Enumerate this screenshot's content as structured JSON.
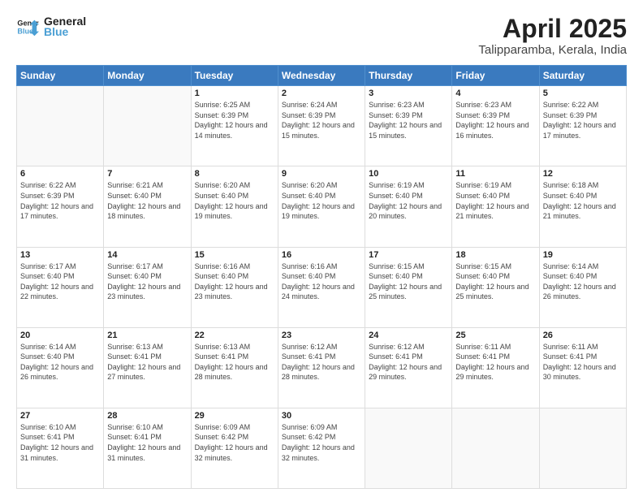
{
  "header": {
    "logo_line1": "General",
    "logo_line2": "Blue",
    "title": "April 2025",
    "subtitle": "Talipparamba, Kerala, India"
  },
  "weekdays": [
    "Sunday",
    "Monday",
    "Tuesday",
    "Wednesday",
    "Thursday",
    "Friday",
    "Saturday"
  ],
  "weeks": [
    [
      {
        "day": "",
        "info": ""
      },
      {
        "day": "",
        "info": ""
      },
      {
        "day": "1",
        "info": "Sunrise: 6:25 AM\nSunset: 6:39 PM\nDaylight: 12 hours and 14 minutes."
      },
      {
        "day": "2",
        "info": "Sunrise: 6:24 AM\nSunset: 6:39 PM\nDaylight: 12 hours and 15 minutes."
      },
      {
        "day": "3",
        "info": "Sunrise: 6:23 AM\nSunset: 6:39 PM\nDaylight: 12 hours and 15 minutes."
      },
      {
        "day": "4",
        "info": "Sunrise: 6:23 AM\nSunset: 6:39 PM\nDaylight: 12 hours and 16 minutes."
      },
      {
        "day": "5",
        "info": "Sunrise: 6:22 AM\nSunset: 6:39 PM\nDaylight: 12 hours and 17 minutes."
      }
    ],
    [
      {
        "day": "6",
        "info": "Sunrise: 6:22 AM\nSunset: 6:39 PM\nDaylight: 12 hours and 17 minutes."
      },
      {
        "day": "7",
        "info": "Sunrise: 6:21 AM\nSunset: 6:40 PM\nDaylight: 12 hours and 18 minutes."
      },
      {
        "day": "8",
        "info": "Sunrise: 6:20 AM\nSunset: 6:40 PM\nDaylight: 12 hours and 19 minutes."
      },
      {
        "day": "9",
        "info": "Sunrise: 6:20 AM\nSunset: 6:40 PM\nDaylight: 12 hours and 19 minutes."
      },
      {
        "day": "10",
        "info": "Sunrise: 6:19 AM\nSunset: 6:40 PM\nDaylight: 12 hours and 20 minutes."
      },
      {
        "day": "11",
        "info": "Sunrise: 6:19 AM\nSunset: 6:40 PM\nDaylight: 12 hours and 21 minutes."
      },
      {
        "day": "12",
        "info": "Sunrise: 6:18 AM\nSunset: 6:40 PM\nDaylight: 12 hours and 21 minutes."
      }
    ],
    [
      {
        "day": "13",
        "info": "Sunrise: 6:17 AM\nSunset: 6:40 PM\nDaylight: 12 hours and 22 minutes."
      },
      {
        "day": "14",
        "info": "Sunrise: 6:17 AM\nSunset: 6:40 PM\nDaylight: 12 hours and 23 minutes."
      },
      {
        "day": "15",
        "info": "Sunrise: 6:16 AM\nSunset: 6:40 PM\nDaylight: 12 hours and 23 minutes."
      },
      {
        "day": "16",
        "info": "Sunrise: 6:16 AM\nSunset: 6:40 PM\nDaylight: 12 hours and 24 minutes."
      },
      {
        "day": "17",
        "info": "Sunrise: 6:15 AM\nSunset: 6:40 PM\nDaylight: 12 hours and 25 minutes."
      },
      {
        "day": "18",
        "info": "Sunrise: 6:15 AM\nSunset: 6:40 PM\nDaylight: 12 hours and 25 minutes."
      },
      {
        "day": "19",
        "info": "Sunrise: 6:14 AM\nSunset: 6:40 PM\nDaylight: 12 hours and 26 minutes."
      }
    ],
    [
      {
        "day": "20",
        "info": "Sunrise: 6:14 AM\nSunset: 6:40 PM\nDaylight: 12 hours and 26 minutes."
      },
      {
        "day": "21",
        "info": "Sunrise: 6:13 AM\nSunset: 6:41 PM\nDaylight: 12 hours and 27 minutes."
      },
      {
        "day": "22",
        "info": "Sunrise: 6:13 AM\nSunset: 6:41 PM\nDaylight: 12 hours and 28 minutes."
      },
      {
        "day": "23",
        "info": "Sunrise: 6:12 AM\nSunset: 6:41 PM\nDaylight: 12 hours and 28 minutes."
      },
      {
        "day": "24",
        "info": "Sunrise: 6:12 AM\nSunset: 6:41 PM\nDaylight: 12 hours and 29 minutes."
      },
      {
        "day": "25",
        "info": "Sunrise: 6:11 AM\nSunset: 6:41 PM\nDaylight: 12 hours and 29 minutes."
      },
      {
        "day": "26",
        "info": "Sunrise: 6:11 AM\nSunset: 6:41 PM\nDaylight: 12 hours and 30 minutes."
      }
    ],
    [
      {
        "day": "27",
        "info": "Sunrise: 6:10 AM\nSunset: 6:41 PM\nDaylight: 12 hours and 31 minutes."
      },
      {
        "day": "28",
        "info": "Sunrise: 6:10 AM\nSunset: 6:41 PM\nDaylight: 12 hours and 31 minutes."
      },
      {
        "day": "29",
        "info": "Sunrise: 6:09 AM\nSunset: 6:42 PM\nDaylight: 12 hours and 32 minutes."
      },
      {
        "day": "30",
        "info": "Sunrise: 6:09 AM\nSunset: 6:42 PM\nDaylight: 12 hours and 32 minutes."
      },
      {
        "day": "",
        "info": ""
      },
      {
        "day": "",
        "info": ""
      },
      {
        "day": "",
        "info": ""
      }
    ]
  ]
}
